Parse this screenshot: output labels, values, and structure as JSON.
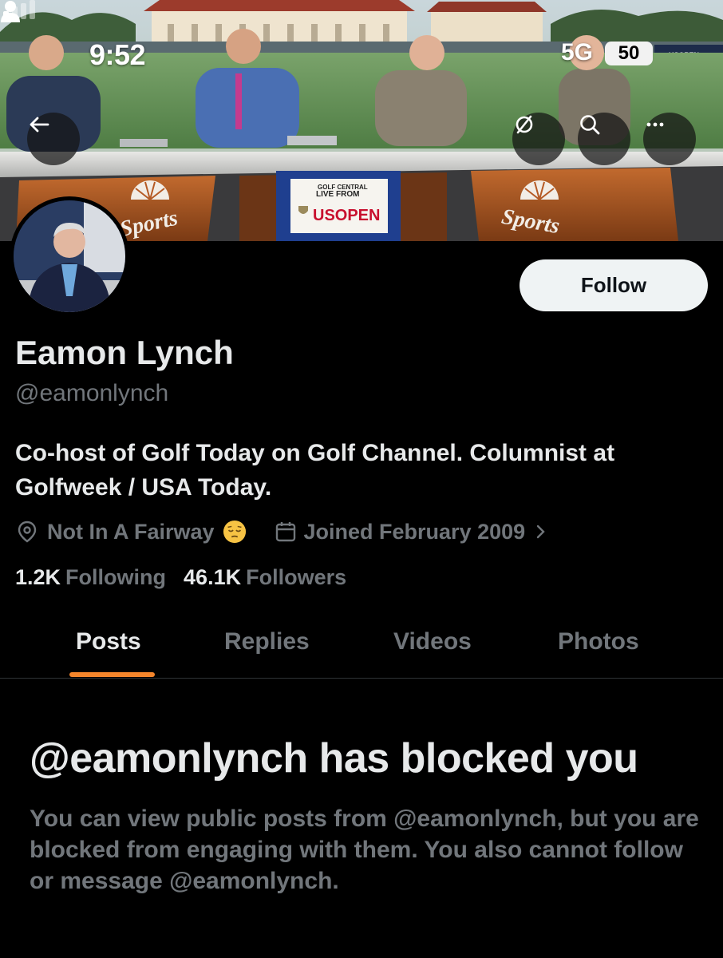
{
  "status_bar": {
    "time": "9:52",
    "network": "5G",
    "battery": "50"
  },
  "banner": {
    "desk_sign_line1": "GOLF CENTRAL",
    "desk_sign_line2": "LIVE FROM",
    "desk_sign_line3": "USOPEN",
    "left_desk_logo": "Sports",
    "right_desk_logo": "Sports",
    "board_text": "USOPEN"
  },
  "nav": {
    "back_icon": "back-arrow-icon",
    "hide_icon": "eye-slash-icon",
    "search_icon": "search-icon",
    "more_icon": "more-icon"
  },
  "profile": {
    "display_name": "Eamon Lynch",
    "handle": "@eamonlynch",
    "bio": "Co-host of Golf Today on Golf Channel. Columnist at Golfweek / USA Today.",
    "location": "Not In A Fairway",
    "joined": "Joined February 2009",
    "follow_label": "Follow",
    "following_count": "1.2K",
    "following_label": "Following",
    "followers_count": "46.1K",
    "followers_label": "Followers"
  },
  "tabs": [
    {
      "label": "Posts",
      "active": true
    },
    {
      "label": "Replies",
      "active": false
    },
    {
      "label": "Videos",
      "active": false
    },
    {
      "label": "Photos",
      "active": false
    }
  ],
  "blocked": {
    "title": "@eamonlynch has blocked you",
    "body": "You can view public posts from @eamonlynch, but you are blocked from engaging with them. You also cannot follow or message @eamonlynch."
  },
  "colors": {
    "background": "#000000",
    "text_primary": "#e7e9ea",
    "text_secondary": "#71767b",
    "tab_indicator": "#f4852b",
    "follow_button_bg": "#eff3f4"
  }
}
